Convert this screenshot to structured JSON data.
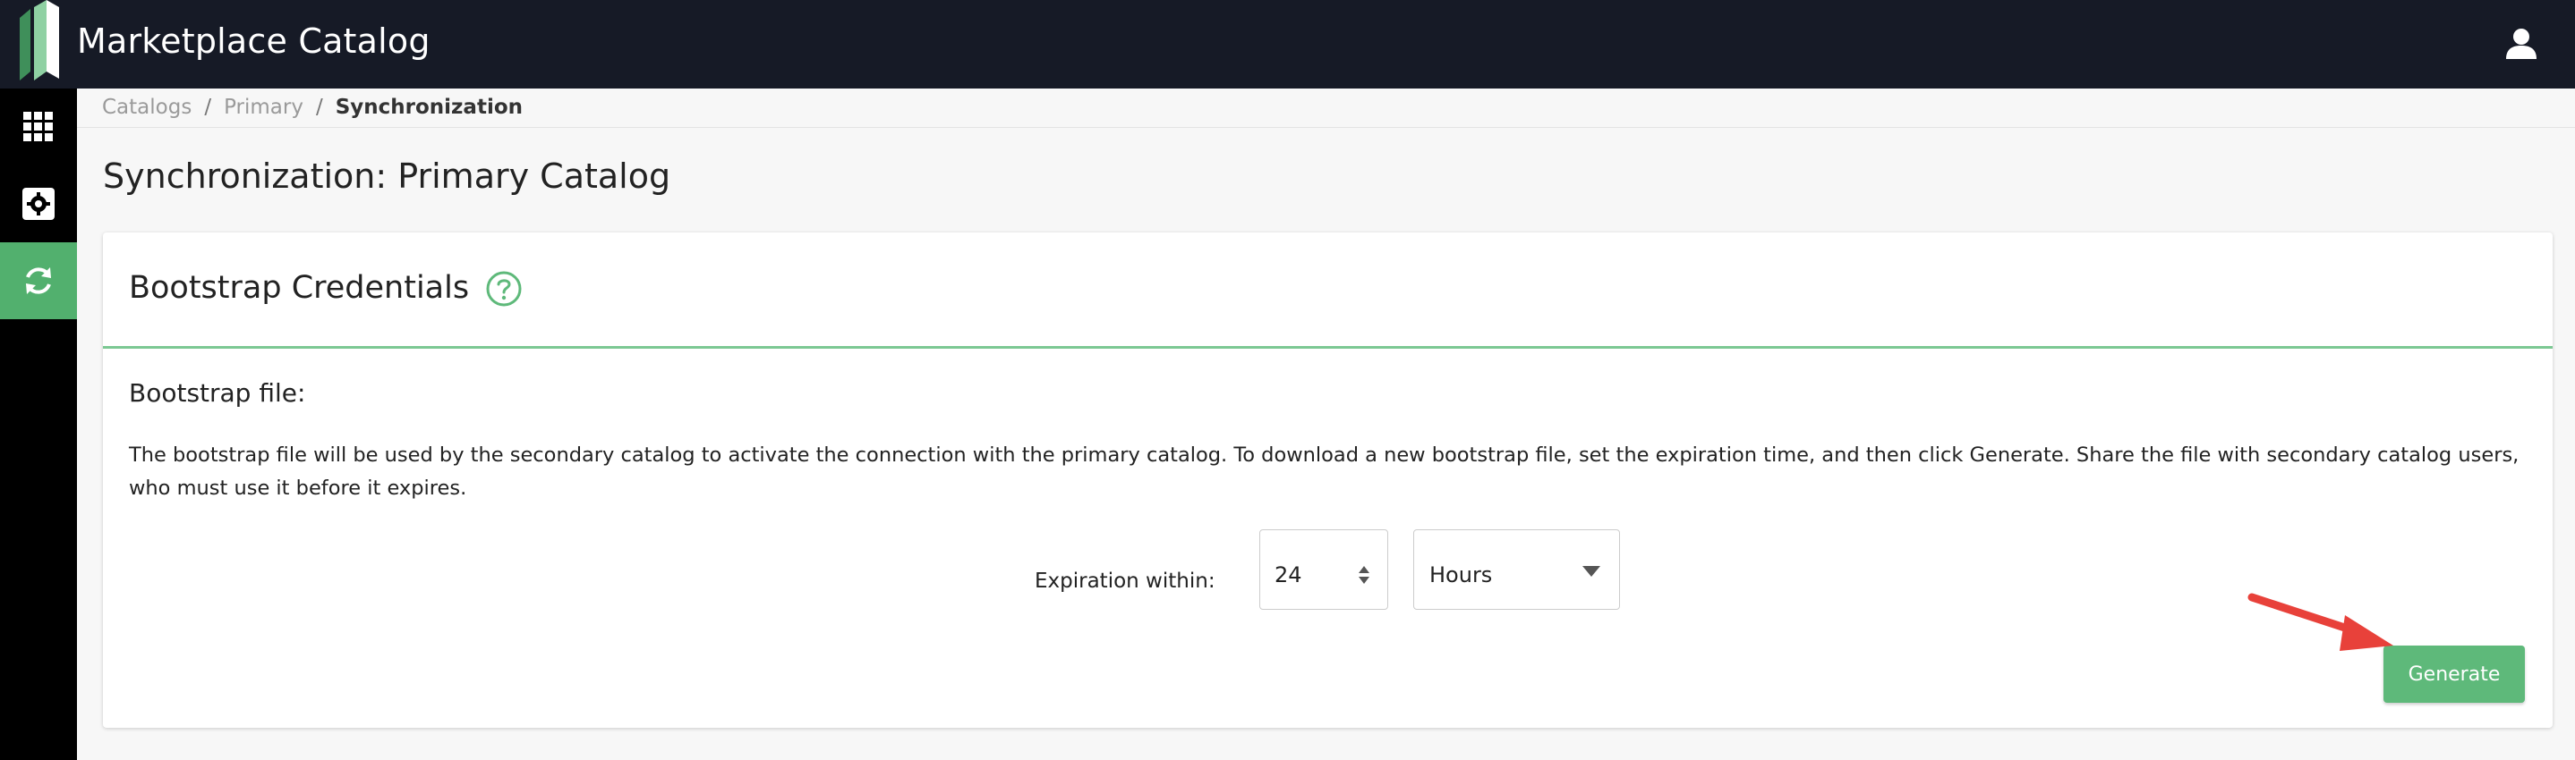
{
  "app": {
    "title": "Marketplace Catalog"
  },
  "icons": {
    "logo": "marketplace-logo",
    "user": "user-icon",
    "apps": "grid-icon",
    "settings": "gear-icon",
    "sync": "sync-icon",
    "help": "question-circle-icon",
    "spinner": "updown-icon",
    "dropdown": "caret-down-icon"
  },
  "breadcrumb": {
    "items": [
      "Catalogs",
      "Primary",
      "Synchronization"
    ],
    "separator": "/"
  },
  "page": {
    "title": "Synchronization: Primary Catalog"
  },
  "card": {
    "title": "Bootstrap Credentials",
    "section_label": "Bootstrap file:",
    "description": "The bootstrap file will be used by the secondary catalog to activate the connection with the primary catalog. To download a new bootstrap file, set the expiration time, and then click Generate. Share the file with secondary catalog users, who must use it before it expires.",
    "expiration_label": "Expiration within:",
    "expiration_value": "24",
    "expiration_unit": "Hours",
    "generate_label": "Generate"
  },
  "colors": {
    "topbar": "#161a26",
    "sidebar": "#000000",
    "accent": "#52b06e",
    "button": "#5eb97a",
    "annotation_arrow": "#e8413a"
  }
}
